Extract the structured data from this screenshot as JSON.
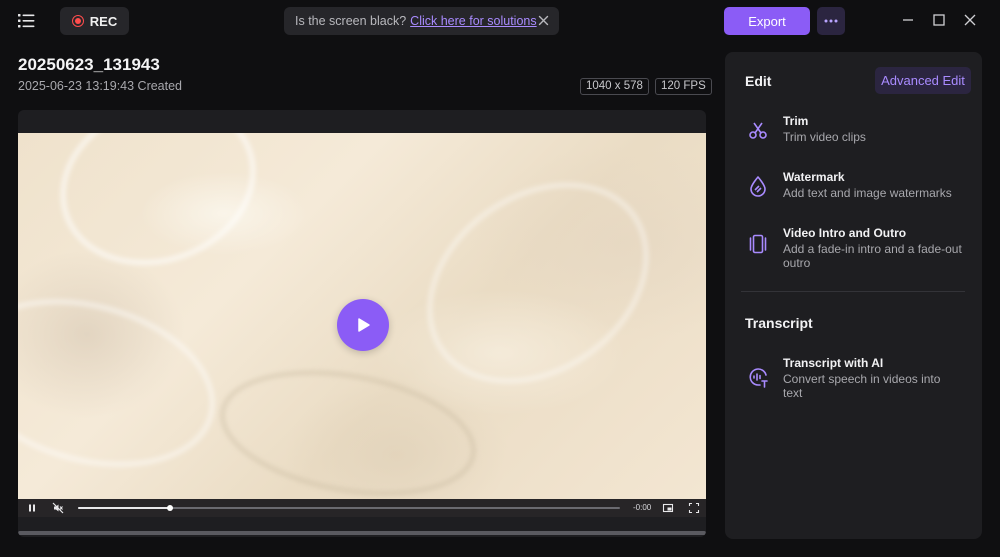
{
  "topbar": {
    "rec_label": "REC",
    "notice_text": "Is the screen black?",
    "notice_link": "Click here for solutions",
    "export_label": "Export",
    "more_label": "•••"
  },
  "recording": {
    "title": "20250623_131943",
    "created": "2025-06-23 13:19:43 Created",
    "resolution": "1040 x 578",
    "fps": "120 FPS"
  },
  "player": {
    "time": "-0:00",
    "progress": 0.17
  },
  "panel": {
    "edit_heading": "Edit",
    "advanced_edit_label": "Advanced Edit",
    "transcript_heading": "Transcript",
    "edit_items": [
      {
        "title": "Trim",
        "desc": "Trim video clips",
        "icon": "scissors-icon"
      },
      {
        "title": "Watermark",
        "desc": "Add text and image watermarks",
        "icon": "watermark-drop-icon"
      },
      {
        "title": "Video Intro and Outro",
        "desc": "Add a fade-in intro and a fade-out outro",
        "icon": "intro-outro-icon"
      }
    ],
    "transcript_items": [
      {
        "title": "Transcript with AI",
        "desc": "Convert speech in videos into text",
        "icon": "ai-transcript-icon"
      }
    ]
  },
  "colors": {
    "accent": "#8b5cf6",
    "accent_text": "#a98bff",
    "background": "#0f0f11",
    "panel": "#1e1e21"
  }
}
